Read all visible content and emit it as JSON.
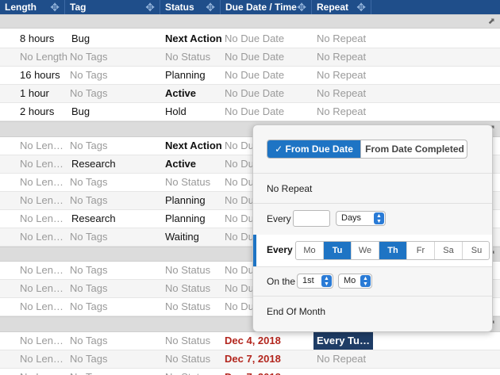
{
  "columns": [
    "Length",
    "Tag",
    "Status",
    "Due Date / Time",
    "Repeat"
  ],
  "rows": [
    {
      "len": "8 hours",
      "tag": "Bug",
      "status": "Next Action",
      "due": "No Due Date",
      "rep": "No Repeat"
    },
    {
      "len": "No Length",
      "tag": "No Tags",
      "status": "No Status",
      "due": "No Due Date",
      "rep": "No Repeat"
    },
    {
      "len": "16 hours",
      "tag": "No Tags",
      "status": "Planning",
      "due": "No Due Date",
      "rep": "No Repeat"
    },
    {
      "len": "1 hour",
      "tag": "No Tags",
      "status": "Active",
      "due": "No Due Date",
      "rep": "No Repeat"
    },
    {
      "len": "2 hours",
      "tag": "Bug",
      "status": "Hold",
      "due": "No Due Date",
      "rep": "No Repeat"
    },
    {
      "len": "No Len…",
      "tag": "No Tags",
      "status": "Next Action",
      "due": "No Du",
      "rep": ""
    },
    {
      "len": "No Len…",
      "tag": "Research",
      "status": "Active",
      "due": "No Du",
      "rep": ""
    },
    {
      "len": "No Len…",
      "tag": "No Tags",
      "status": "No Status",
      "due": "No Du",
      "rep": ""
    },
    {
      "len": "No Len…",
      "tag": "No Tags",
      "status": "Planning",
      "due": "No Du",
      "rep": ""
    },
    {
      "len": "No Len…",
      "tag": "Research",
      "status": "Planning",
      "due": "No Du",
      "rep": ""
    },
    {
      "len": "No Len…",
      "tag": "No Tags",
      "status": "Waiting",
      "due": "No Du",
      "rep": ""
    },
    {
      "len": "No Len…",
      "tag": "No Tags",
      "status": "No Status",
      "due": "No Du",
      "rep": ""
    },
    {
      "len": "No Len…",
      "tag": "No Tags",
      "status": "No Status",
      "due": "No Du",
      "rep": ""
    },
    {
      "len": "No Len…",
      "tag": "No Tags",
      "status": "No Status",
      "due": "No Du",
      "rep": ""
    },
    {
      "len": "No Len…",
      "tag": "No Tags",
      "status": "No Status",
      "due": "Dec 4, 2018",
      "rep": "Every Tu…"
    },
    {
      "len": "No Len…",
      "tag": "No Tags",
      "status": "No Status",
      "due": "Dec 7, 2018",
      "rep": "No Repeat"
    },
    {
      "len": "No Len…",
      "tag": "No Tags",
      "status": "No Status",
      "due": "Dec 7, 2018",
      "rep": ""
    }
  ],
  "repeat_popover": {
    "mode_from_due": "From Due Date",
    "mode_from_completed": "From Date Completed",
    "mode_selected": "From Due Date",
    "no_repeat": "No Repeat",
    "every_label": "Every",
    "every_value": "",
    "interval_unit": "Days",
    "weekly_label": "Every",
    "days": [
      "Mo",
      "Tu",
      "We",
      "Th",
      "Fr",
      "Sa",
      "Su"
    ],
    "selected_days": [
      "Tu",
      "Th"
    ],
    "on_the_label": "On the",
    "ordinal_value": "1st",
    "weekday_value": "Mo",
    "end_of_month": "End Of Month"
  },
  "icons": {
    "column_move": "move-icon",
    "group_expand": "expand-arrow-icon",
    "checkmark": "checkmark-icon",
    "select_arrows": "updown-arrows-icon"
  },
  "colors": {
    "header_bg": "#1f4e8a",
    "accent": "#1e74c4",
    "due_date_red": "#b3261e",
    "chip_bg": "#1f3d66"
  }
}
